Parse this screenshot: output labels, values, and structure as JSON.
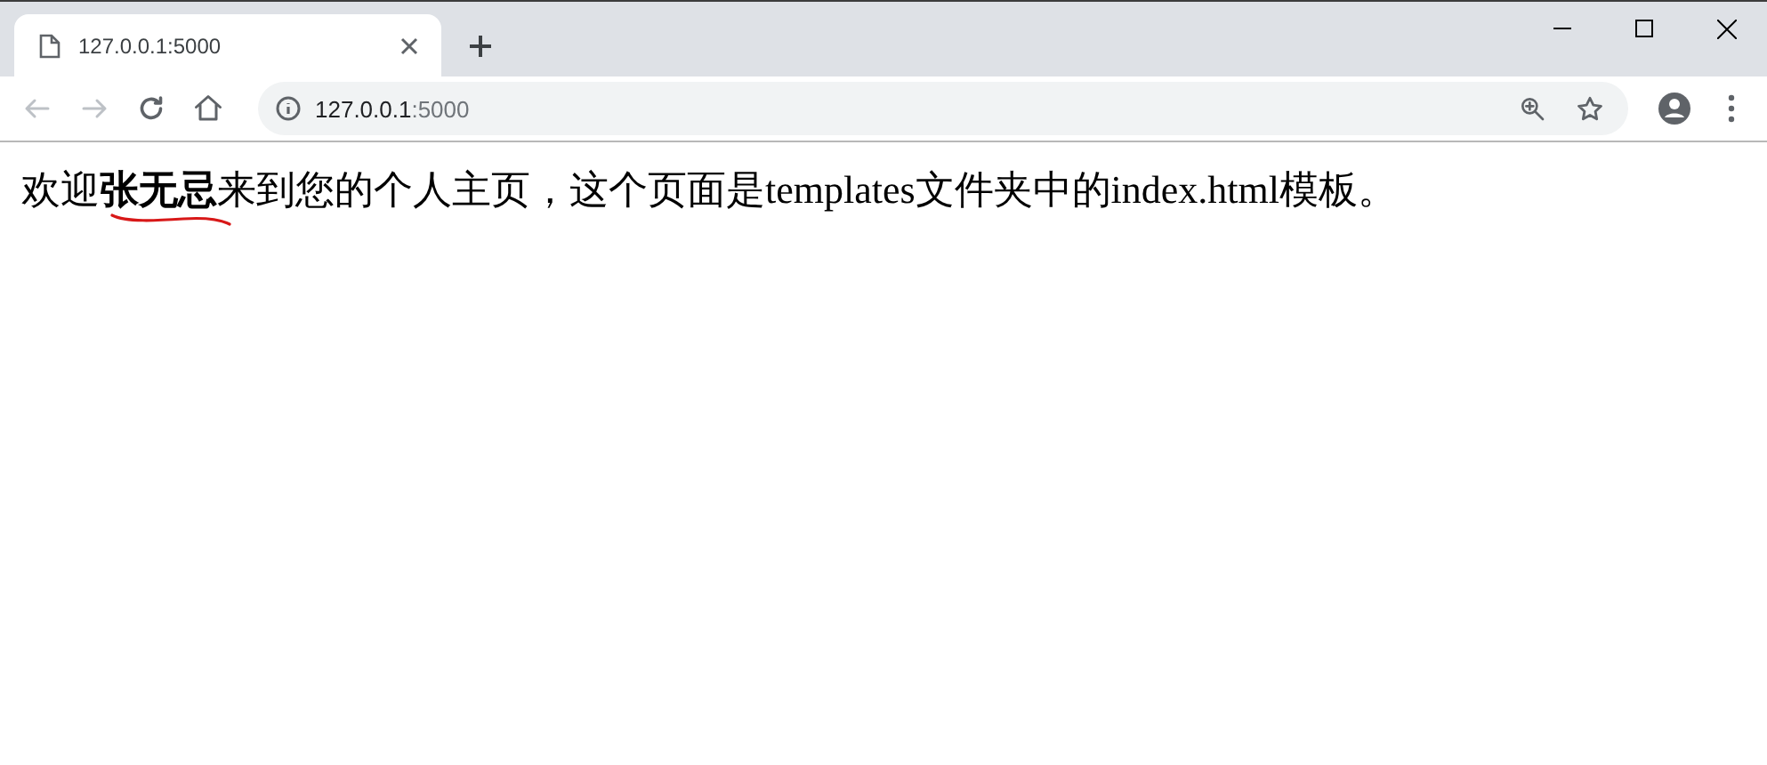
{
  "tabs": [
    {
      "title": "127.0.0.1:5000",
      "selected": true
    }
  ],
  "address_bar": {
    "host": "127.0.0.1",
    "port": ":5000"
  },
  "page": {
    "text": "欢迎**张无忌**来到您的个人主页，这个页面是templates文件夹中的index.html模板。",
    "annotations": [
      {
        "kind": "squiggle",
        "color": "#d81818"
      }
    ]
  }
}
